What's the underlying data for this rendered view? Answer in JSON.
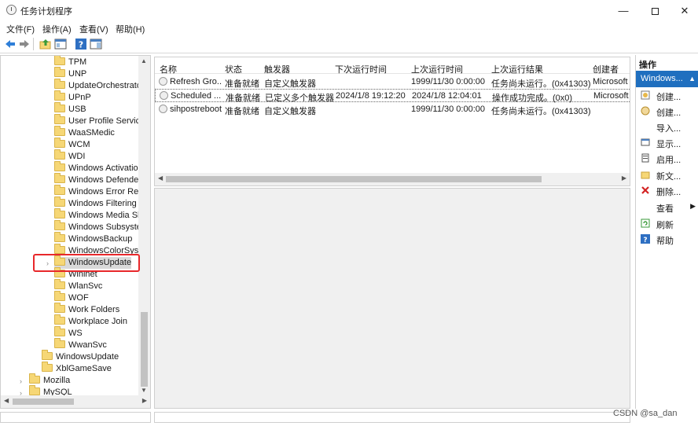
{
  "window": {
    "title": "任务计划程序"
  },
  "menu": [
    "文件(F)",
    "操作(A)",
    "查看(V)",
    "帮助(H)"
  ],
  "tree": {
    "items": [
      {
        "label": "TPM",
        "level": 2
      },
      {
        "label": "UNP",
        "level": 2
      },
      {
        "label": "UpdateOrchestrato",
        "level": 2
      },
      {
        "label": "UPnP",
        "level": 2
      },
      {
        "label": "USB",
        "level": 2
      },
      {
        "label": "User Profile Service",
        "level": 2
      },
      {
        "label": "WaaSMedic",
        "level": 2
      },
      {
        "label": "WCM",
        "level": 2
      },
      {
        "label": "WDI",
        "level": 2
      },
      {
        "label": "Windows Activation",
        "level": 2
      },
      {
        "label": "Windows Defender",
        "level": 2
      },
      {
        "label": "Windows Error Repo",
        "level": 2
      },
      {
        "label": "Windows Filtering F",
        "level": 2
      },
      {
        "label": "Windows Media Sha",
        "level": 2
      },
      {
        "label": "Windows Subsyster",
        "level": 2
      },
      {
        "label": "WindowsBackup",
        "level": 2
      },
      {
        "label": "WindowsColorSyste",
        "level": 2
      },
      {
        "label": "WindowsUpdate",
        "level": 2
      },
      {
        "label": "Wininet",
        "level": 2
      },
      {
        "label": "WlanSvc",
        "level": 2
      },
      {
        "label": "WOF",
        "level": 2
      },
      {
        "label": "Work Folders",
        "level": 2
      },
      {
        "label": "Workplace Join",
        "level": 2
      },
      {
        "label": "WS",
        "level": 2
      },
      {
        "label": "WwanSvc",
        "level": 2
      },
      {
        "label": "WindowsUpdate",
        "level": 1
      },
      {
        "label": "XblGameSave",
        "level": 1
      },
      {
        "label": "Mozilla",
        "level": 0
      },
      {
        "label": "MySQL",
        "level": 0
      }
    ]
  },
  "tasks": {
    "columns": [
      "名称",
      "状态",
      "触发器",
      "下次运行时间",
      "上次运行时间",
      "上次运行结果",
      "创建者"
    ],
    "rows": [
      [
        "Refresh Gro...",
        "准备就绪",
        "自定义触发器",
        "",
        "1999/11/30 0:00:00",
        "任务尚未运行。(0x41303)",
        "Microsoft"
      ],
      [
        "Scheduled ...",
        "准备就绪",
        "已定义多个触发器",
        "2024/1/8 19:12:20",
        "2024/1/8 12:04:01",
        "操作成功完成。(0x0)",
        "Microsoft"
      ],
      [
        "sihpostreboot",
        "准备就绪",
        "自定义触发器",
        "",
        "1999/11/30 0:00:00",
        "任务尚未运行。(0x41303)",
        ""
      ]
    ]
  },
  "actions": {
    "title": "操作",
    "group": "Windows...",
    "items": [
      "创建...",
      "创建...",
      "导入...",
      "显示...",
      "启用...",
      "新文...",
      "删除...",
      "查看",
      "刷新",
      "帮助"
    ]
  },
  "watermark": "CSDN @sa_dan",
  "colors": {
    "accent": "#1f6fbf",
    "highlight": "#e8282b",
    "folder": "#f6d776"
  }
}
